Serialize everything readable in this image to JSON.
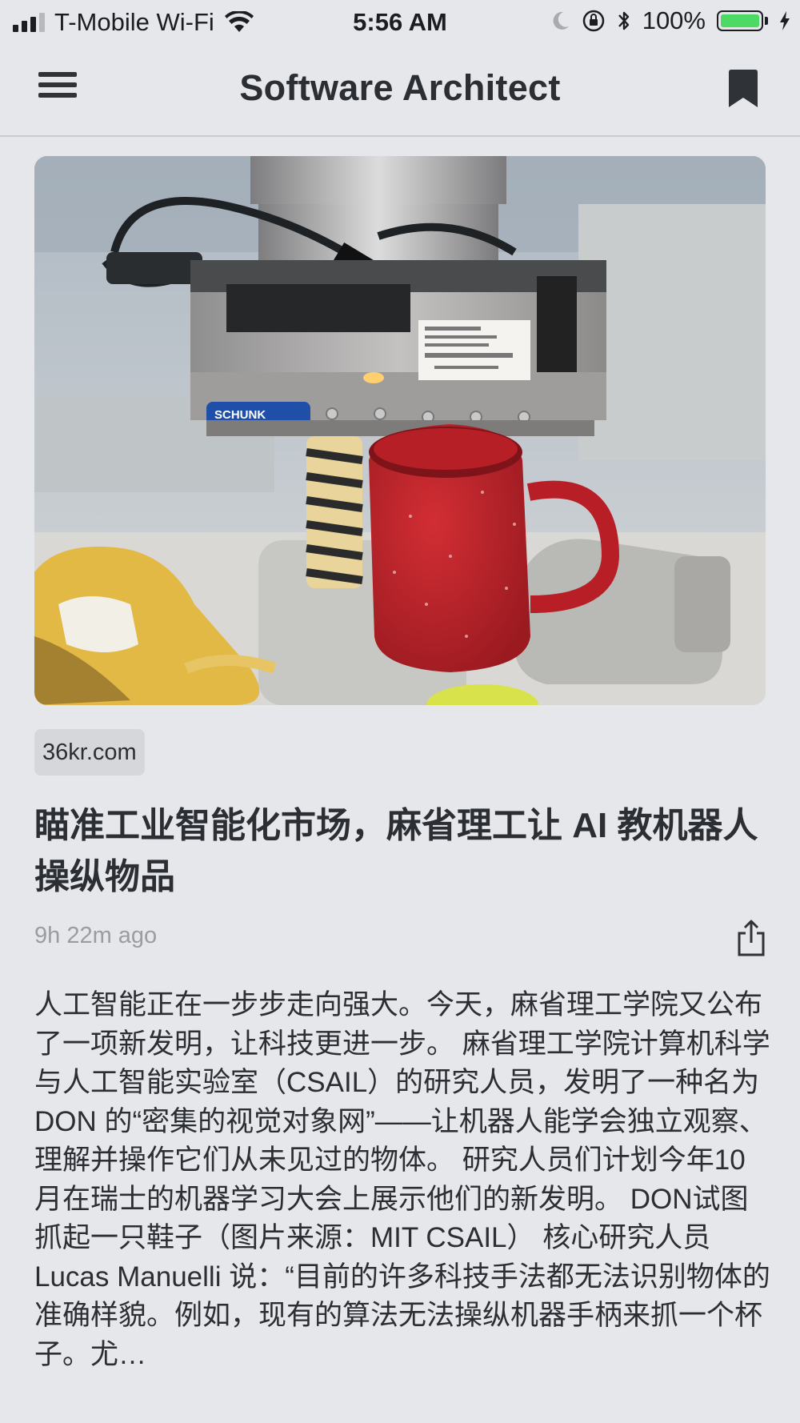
{
  "status_bar": {
    "carrier": "T-Mobile Wi-Fi",
    "time": "5:56 AM",
    "battery_percent": "100%",
    "battery_level": 1.0,
    "signal_bars": 3,
    "signal_bars_total": 4,
    "icons": [
      "signal-icon",
      "wifi-icon",
      "moon-icon",
      "rotation-lock-icon",
      "bluetooth-icon",
      "battery-icon",
      "charging-icon"
    ]
  },
  "nav": {
    "title": "Software Architect",
    "left_icon": "hamburger-menu-icon",
    "right_icon": "bookmark-icon"
  },
  "article": {
    "image_description_icon": "robot-gripper-photo",
    "source": "36kr.com",
    "title": "瞄准工业智能化市场，麻省理工让 AI 教机器人操纵物品",
    "time_ago": "9h 22m ago",
    "share_icon": "share-icon",
    "body": "人工智能正在一步步走向强大。今天，麻省理工学院又公布了一项新发明，让科技更进一步。 麻省理工学院计算机科学与人工智能实验室（CSAIL）的研究人员，发明了一种名为 DON 的“密集的视觉对象网”——让机器人能学会独立观察、理解并操作它们从未见过的物体。 研究人员们计划今年10月在瑞士的机器学习大会上展示他们的新发明。 DON试图抓起一只鞋子（图片来源：MIT CSAIL） 核心研究人员 Lucas Manuelli 说：“目前的许多科技手法都无法识别物体的准确样貌。例如，现有的算法无法操纵机器手柄来抓一个杯子。尤…"
  },
  "photo_labels": {
    "brand": "SCHUNK"
  },
  "colors": {
    "background": "#e6e7eb",
    "text": "#2b2e33",
    "muted": "#9a9ca1",
    "battery": "#4cd964",
    "mug": "#c0242b"
  }
}
